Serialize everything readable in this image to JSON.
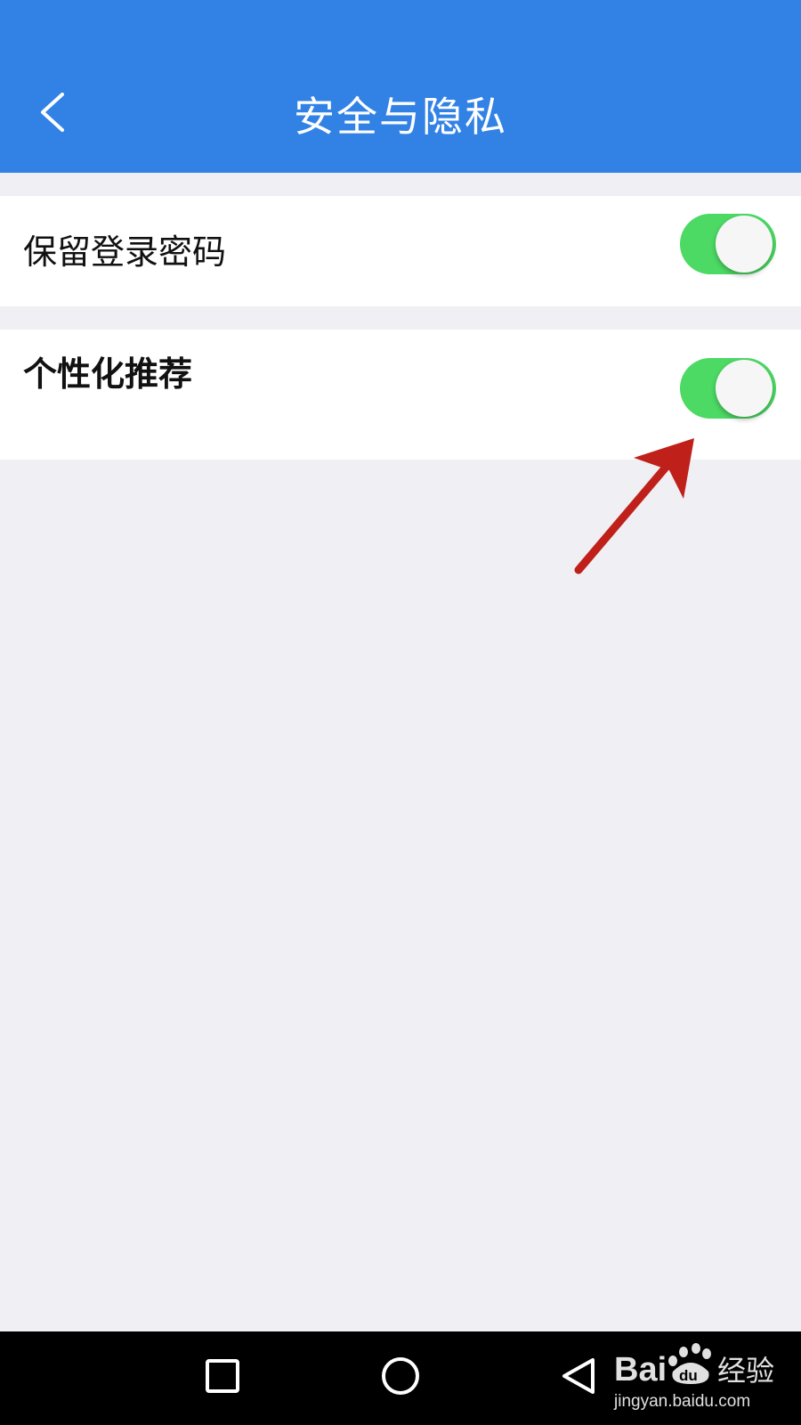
{
  "header": {
    "title": "安全与隐私",
    "back_icon": "chevron-left-icon",
    "background_color": "#3282e6"
  },
  "settings": [
    {
      "label": "保留登录密码",
      "enabled": true
    },
    {
      "label": "个性化推荐",
      "enabled": true
    }
  ],
  "toggle_on_color": "#4cd964",
  "annotation": {
    "type": "arrow",
    "color": "#c0201a",
    "points_to": "个性化推荐 toggle"
  },
  "navbar": {
    "buttons": [
      "recent-apps-square-icon",
      "home-circle-icon",
      "back-triangle-icon"
    ]
  },
  "watermark": {
    "brand": "Baidu经验",
    "url": "jingyan.baidu.com"
  }
}
